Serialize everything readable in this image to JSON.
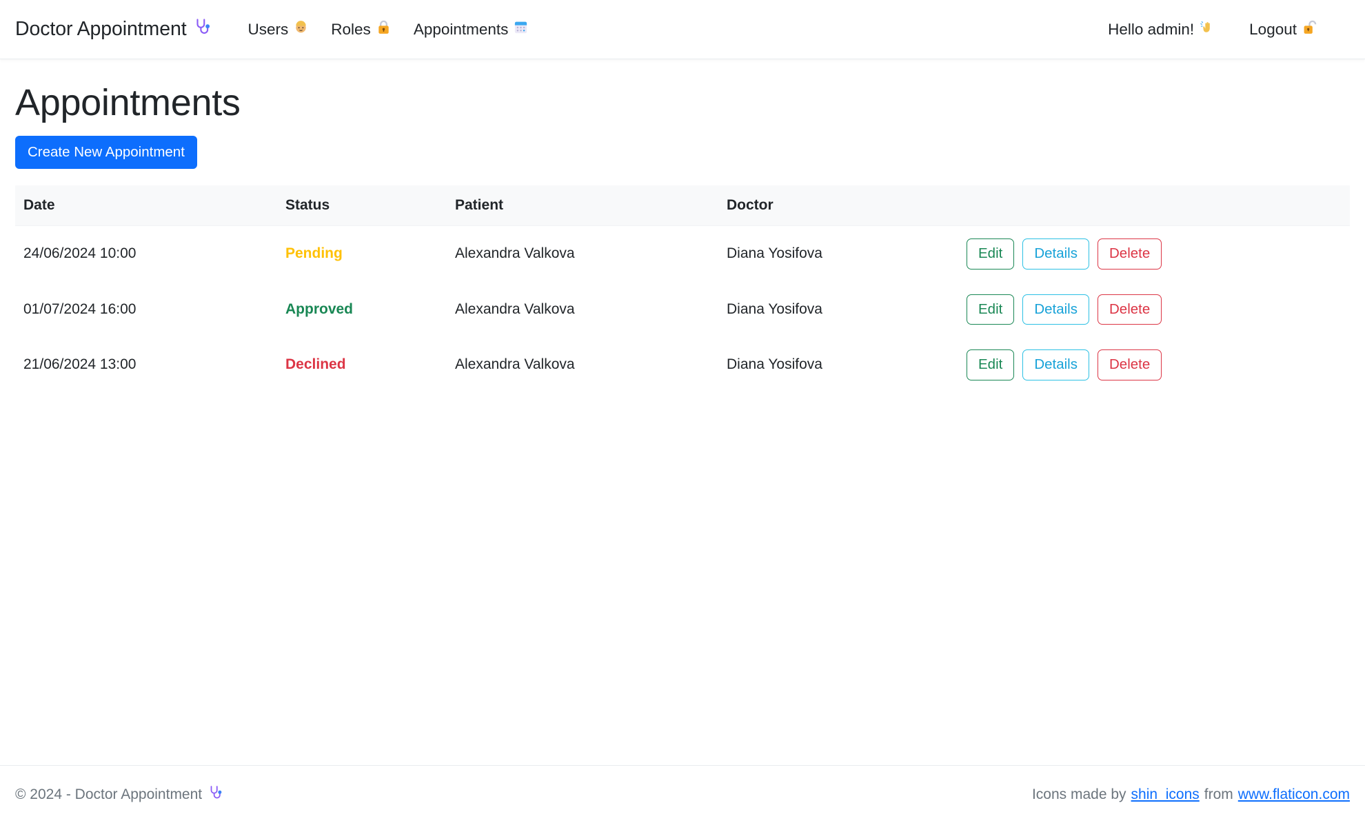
{
  "navbar": {
    "brand": "Doctor Appointment",
    "brand_icon": "stethoscope-icon",
    "links": [
      {
        "label": "Users",
        "icon": "person-icon"
      },
      {
        "label": "Roles",
        "icon": "lock-icon"
      },
      {
        "label": "Appointments",
        "icon": "calendar-icon"
      }
    ],
    "greeting": "Hello admin!",
    "greeting_icon": "waving-hand-icon",
    "logout": "Logout",
    "logout_icon": "unlocked-padlock-icon"
  },
  "main": {
    "title": "Appointments",
    "create_button": "Create New Appointment"
  },
  "table": {
    "headers": [
      "Date",
      "Status",
      "Patient",
      "Doctor"
    ],
    "rows": [
      {
        "date": "24/06/2024 10:00",
        "status": "Pending",
        "status_kind": "pending",
        "patient": "Alexandra Valkova",
        "doctor": "Diana Yosifova",
        "edit": "Edit",
        "details": "Details",
        "delete": "Delete"
      },
      {
        "date": "01/07/2024 16:00",
        "status": "Approved",
        "status_kind": "approved",
        "patient": "Alexandra Valkova",
        "doctor": "Diana Yosifova",
        "edit": "Edit",
        "details": "Details",
        "delete": "Delete"
      },
      {
        "date": "21/06/2024 13:00",
        "status": "Declined",
        "status_kind": "declined",
        "patient": "Alexandra Valkova",
        "doctor": "Diana Yosifova",
        "edit": "Edit",
        "details": "Details",
        "delete": "Delete"
      }
    ]
  },
  "footer": {
    "copyright": "© 2024 - Doctor Appointment",
    "copyright_icon": "stethoscope-icon",
    "credit_prefix": "Icons made by",
    "credit_author": "shin_icons",
    "credit_middle": "from",
    "credit_site": "www.flaticon.com"
  },
  "colors": {
    "primary": "#0d6efd",
    "pending": "#ffc107",
    "approved": "#198754",
    "declined": "#dc3545",
    "info": "#2bc0e4",
    "header_bg": "#f8f9fa",
    "muted": "#6c757d"
  }
}
